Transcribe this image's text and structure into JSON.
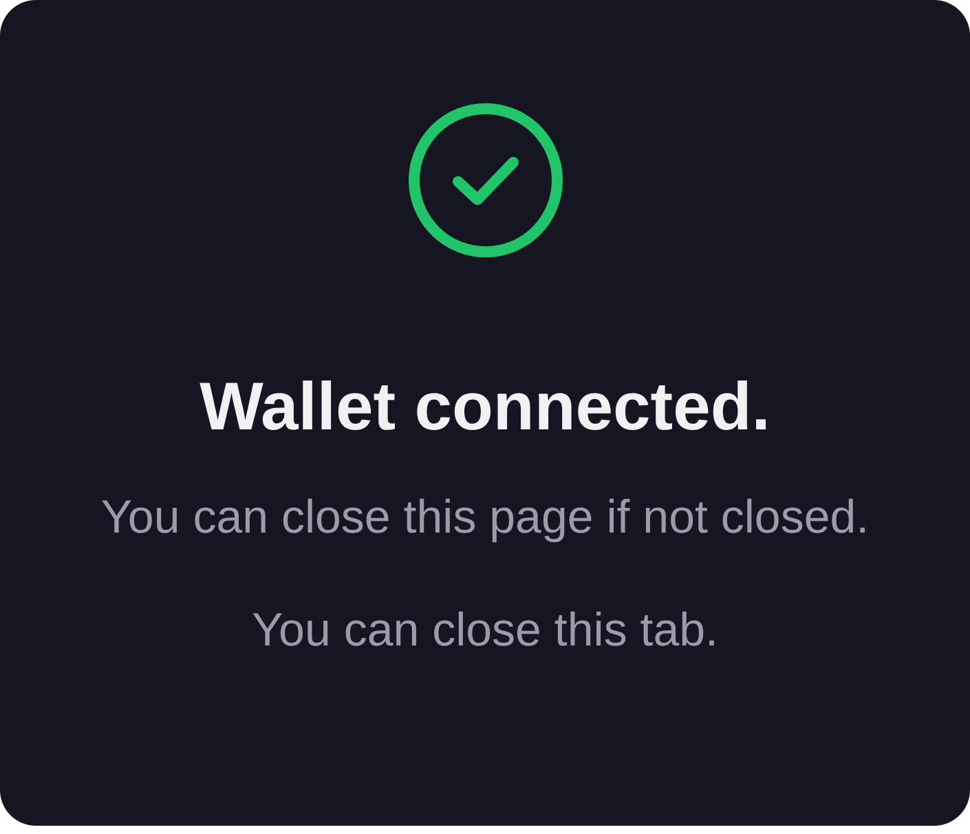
{
  "status": {
    "kind": "success"
  },
  "title": "Wallet connected.",
  "messages": [
    "You can close this page if not closed.",
    "You can close this tab."
  ]
}
